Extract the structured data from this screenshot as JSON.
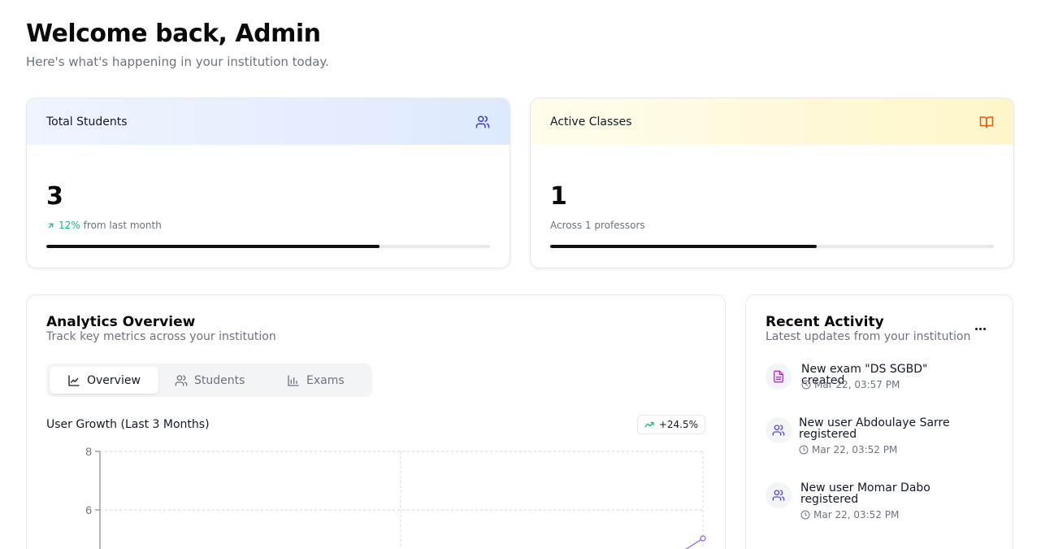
{
  "header": {
    "title": "Welcome back, Admin",
    "subtitle": "Here's what's happening in your institution today."
  },
  "stats": {
    "students": {
      "label": "Total Students",
      "value": "3",
      "trend": "12%",
      "trend_text": "from last month",
      "progress": 0.75,
      "icon": "users-icon"
    },
    "classes": {
      "label": "Active Classes",
      "value": "1",
      "sub_text": "Across 1 professors",
      "progress": 0.6,
      "icon": "book-icon"
    }
  },
  "analytics": {
    "title": "Analytics Overview",
    "subtitle": "Track key metrics across your institution",
    "tabs": [
      {
        "label": "Overview",
        "icon": "line-chart-icon",
        "active": true
      },
      {
        "label": "Students",
        "icon": "users-icon",
        "active": false
      },
      {
        "label": "Exams",
        "icon": "bar-chart-icon",
        "active": false
      }
    ],
    "chart_title": "User Growth (Last 3 Months)",
    "growth_badge": "+24.5%"
  },
  "chart_data": {
    "type": "line",
    "title": "User Growth (Last 3 Months)",
    "xlabel": "",
    "ylabel": "",
    "yticks": [
      "8",
      "6"
    ],
    "ylim": [
      0,
      8
    ],
    "grid": true,
    "series": [
      {
        "values_visible_end": 4.9,
        "color": "#8b5cf6"
      }
    ]
  },
  "activity": {
    "title": "Recent Activity",
    "subtitle": "Latest updates from your institution",
    "items": [
      {
        "title": "New exam \"DS SGBD\" created",
        "time": "Mar 22, 03:57 PM",
        "icon": "file-text-icon",
        "color": "#c026d3"
      },
      {
        "title": "New user Abdoulaye Sarre registered",
        "time": "Mar 22, 03:52 PM",
        "icon": "users-icon",
        "color": "#4f46e5"
      },
      {
        "title": "New user Momar Dabo registered",
        "time": "Mar 22, 03:52 PM",
        "icon": "users-icon",
        "color": "#4f46e5"
      }
    ]
  },
  "colors": {
    "accent_blue": "#4338ca",
    "accent_orange": "#ea580c",
    "trend_green": "#10b981",
    "line_purple": "#8b5cf6"
  }
}
